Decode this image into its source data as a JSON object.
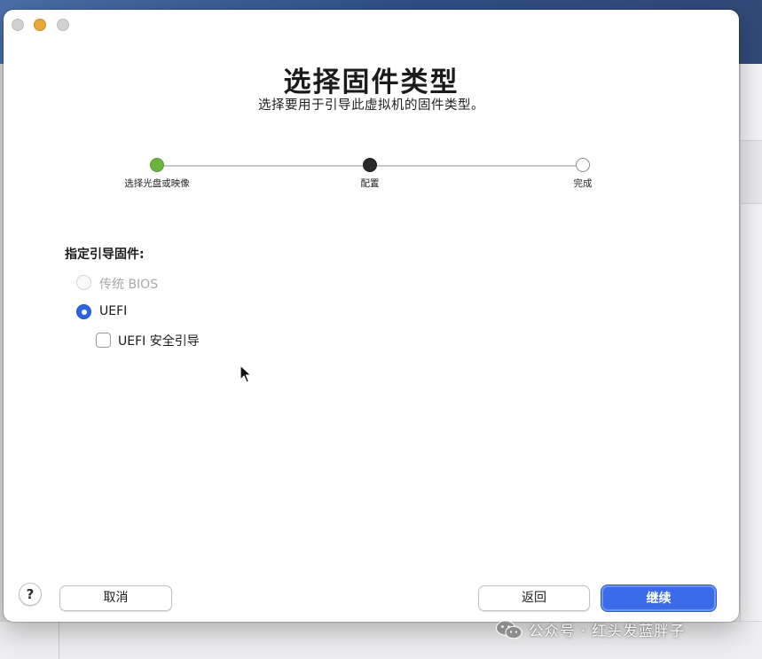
{
  "window": {
    "title": "选择固件类型",
    "subtitle": "选择要用于引导此虚拟机的固件类型。"
  },
  "steps": [
    {
      "label": "选择光盘或映像",
      "state": "done"
    },
    {
      "label": "配置",
      "state": "current"
    },
    {
      "label": "完成",
      "state": "pending"
    }
  ],
  "firmware": {
    "section_label": "指定引导固件:",
    "options": [
      {
        "label": "传统 BIOS",
        "enabled": false,
        "selected": false
      },
      {
        "label": "UEFI",
        "enabled": true,
        "selected": true
      }
    ],
    "secure_boot": {
      "label": "UEFI 安全引导",
      "checked": false
    }
  },
  "footer": {
    "help_label": "?",
    "cancel_label": "取消",
    "back_label": "返回",
    "continue_label": "继续"
  },
  "watermark": {
    "text": "公众号 · 红头发蓝胖子"
  },
  "colors": {
    "accent": "#3a6be8",
    "step_done": "#6cb33e",
    "step_current": "#2a2a2a",
    "traffic_minimize": "#e8a838"
  }
}
